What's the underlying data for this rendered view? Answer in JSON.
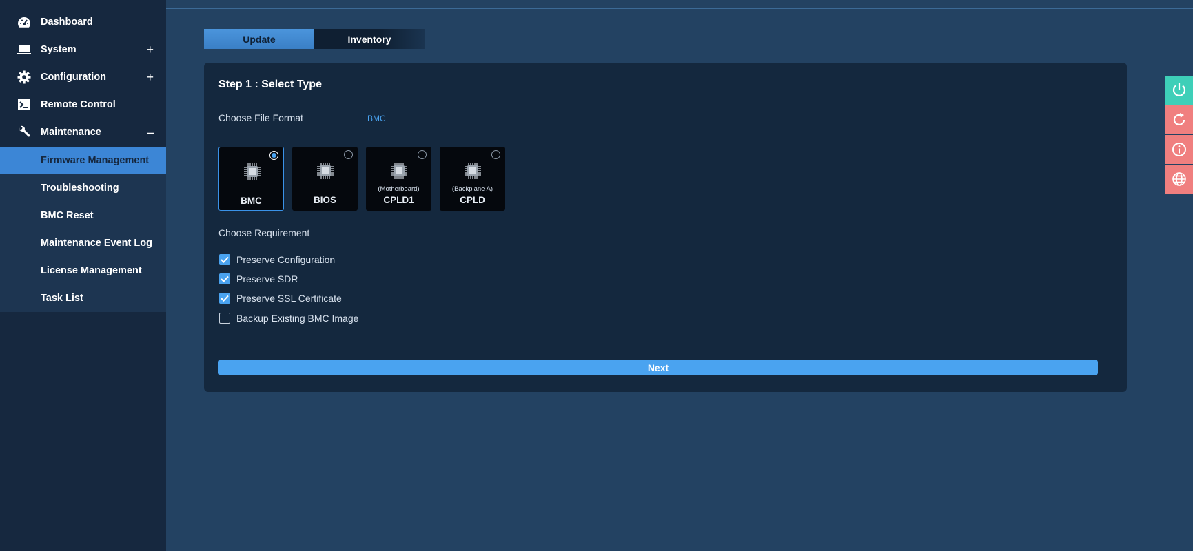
{
  "sidebar": {
    "items": [
      {
        "label": "Dashboard",
        "icon": "dashboard-icon",
        "toggle": ""
      },
      {
        "label": "System",
        "icon": "monitor-icon",
        "toggle": "+"
      },
      {
        "label": "Configuration",
        "icon": "gear-icon",
        "toggle": "+"
      },
      {
        "label": "Remote Control",
        "icon": "terminal-icon",
        "toggle": ""
      },
      {
        "label": "Maintenance",
        "icon": "wrench-icon",
        "toggle": "–"
      }
    ],
    "submenu": [
      {
        "label": "Firmware Management",
        "active": true
      },
      {
        "label": "Troubleshooting"
      },
      {
        "label": "BMC Reset"
      },
      {
        "label": "Maintenance Event Log"
      },
      {
        "label": "License Management"
      },
      {
        "label": "Task List"
      }
    ]
  },
  "tabs": [
    {
      "label": "Update",
      "active": true
    },
    {
      "label": "Inventory",
      "active": false
    }
  ],
  "card": {
    "step_title": "Step 1 : Select Type",
    "file_format_label": "Choose File Format",
    "file_format_value": "BMC",
    "types": [
      {
        "name": "BMC",
        "sub": "",
        "selected": true
      },
      {
        "name": "BIOS",
        "sub": "",
        "selected": false
      },
      {
        "name": "CPLD1",
        "sub": "(Motherboard)",
        "selected": false
      },
      {
        "name": "CPLD",
        "sub": "(Backplane A)",
        "selected": false
      }
    ],
    "requirement_label": "Choose Requirement",
    "requirements": [
      {
        "label": "Preserve Configuration",
        "checked": true
      },
      {
        "label": "Preserve SDR",
        "checked": true
      },
      {
        "label": "Preserve SSL Certificate",
        "checked": true
      },
      {
        "label": "Backup Existing BMC Image",
        "checked": false
      }
    ],
    "next_label": "Next"
  },
  "toolbar": [
    {
      "icon": "power-icon",
      "color": "#3ecfb8"
    },
    {
      "icon": "refresh-icon",
      "color": "#f07f7f"
    },
    {
      "icon": "info-icon",
      "color": "#f07f7f"
    },
    {
      "icon": "globe-icon",
      "color": "#f07f7f"
    }
  ],
  "colors": {
    "background": "#234262",
    "sidebar": "#16283f",
    "submenu": "#1d3551",
    "accent": "#4aa3f0",
    "card": "#14283e"
  }
}
